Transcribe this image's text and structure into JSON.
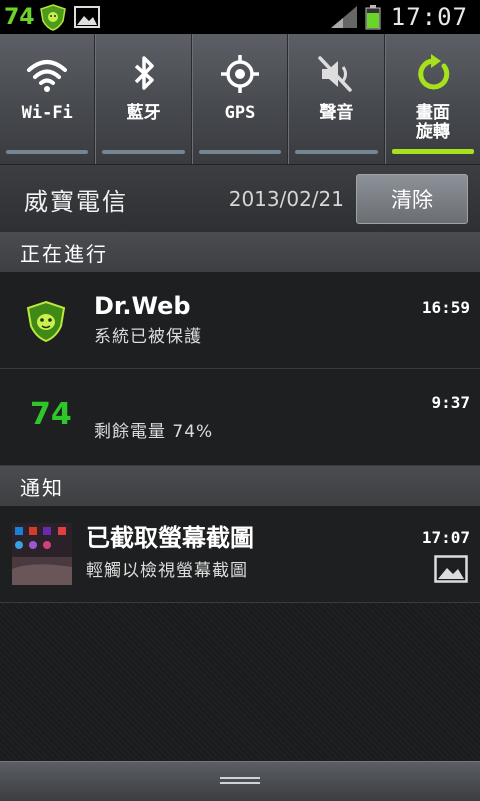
{
  "status_bar": {
    "battery_percent_text": "74",
    "time": "17:07",
    "icons": [
      "drweb-shield-icon",
      "image-icon",
      "signal-icon",
      "battery-icon"
    ]
  },
  "quick_settings": [
    {
      "label": "Wi-Fi",
      "icon": "wifi-icon",
      "active": false
    },
    {
      "label": "藍牙",
      "icon": "bluetooth-icon",
      "active": false
    },
    {
      "label": "GPS",
      "icon": "gps-icon",
      "active": false
    },
    {
      "label": "聲音",
      "icon": "sound-muted-icon",
      "active": false
    },
    {
      "label": "畫面\n旋轉",
      "label_line1": "畫面",
      "label_line2": "旋轉",
      "icon": "rotate-icon",
      "active": true
    }
  ],
  "carrier": {
    "name": "威寶電信",
    "date": "2013/02/21",
    "clear_label": "清除"
  },
  "sections": {
    "ongoing": "正在進行",
    "notifications": "通知"
  },
  "ongoing": [
    {
      "title": "Dr.Web",
      "text": "系統已被保護",
      "time": "16:59",
      "icon": "drweb-shield-icon"
    },
    {
      "icon_text": "74",
      "text": "剩餘電量 74%",
      "time": "9:37"
    }
  ],
  "notifications": [
    {
      "title": "已截取螢幕截圖",
      "text": "輕觸以檢視螢幕截圖",
      "time": "17:07",
      "icon": "screenshot-thumbnail",
      "small_icon": "image-icon"
    }
  ],
  "colors": {
    "accent_green": "#a6e11c",
    "battery_green": "#6bd42a"
  }
}
